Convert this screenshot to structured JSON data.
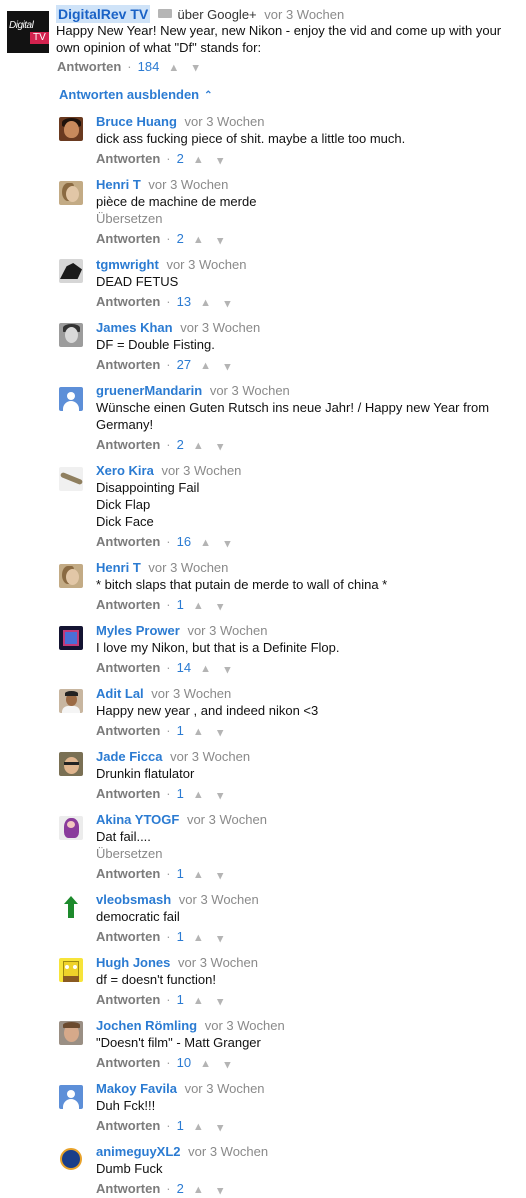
{
  "top_comment": {
    "author": "DigitalRev TV",
    "avatar_lines": [
      "Digital",
      "TV"
    ],
    "via": "über Google+",
    "time": "vor 3 Wochen",
    "text": "Happy New Year! New year, new Nikon - enjoy the vid and come up with your own opinion of what \"Df\" stands for:",
    "reply_label": "Antworten",
    "likes": "184"
  },
  "hide_replies": {
    "label": "Antworten ausblenden",
    "icon": "chevron-up-icon"
  },
  "ui": {
    "reply_label": "Antworten",
    "translate_label": "Übersetzen",
    "like_icon": "thumbs-up-icon",
    "dislike_icon": "thumbs-down-icon"
  },
  "replies": [
    {
      "author": "Bruce Huang",
      "time": "vor 3 Wochen",
      "lines": [
        "dick ass fucking piece of shit. maybe a little too much."
      ],
      "likes": "2"
    },
    {
      "author": "Henri T",
      "time": "vor 3 Wochen",
      "lines": [
        "pièce de machine de merde"
      ],
      "translate": "Übersetzen",
      "likes": "2"
    },
    {
      "author": "tgmwright",
      "time": "vor 3 Wochen",
      "lines": [
        "DEAD FETUS"
      ],
      "likes": "13"
    },
    {
      "author": "James Khan",
      "time": "vor 3 Wochen",
      "lines": [
        "DF = Double Fisting."
      ],
      "likes": "27"
    },
    {
      "author": "gruenerMandarin",
      "time": "vor 3 Wochen",
      "lines": [
        "Wünsche einen Guten Rutsch ins neue Jahr! / Happy new Year from",
        "Germany!"
      ],
      "likes": "2"
    },
    {
      "author": "Xero Kira",
      "time": "vor 3 Wochen",
      "lines": [
        "Disappointing Fail",
        "Dick Flap",
        "Dick Face"
      ],
      "likes": "16"
    },
    {
      "author": "Henri T",
      "time": "vor 3 Wochen",
      "lines": [
        "* bitch slaps that putain de merde to wall of china *"
      ],
      "likes": "1"
    },
    {
      "author": "Myles Prower",
      "time": "vor 3 Wochen",
      "lines": [
        "I love my Nikon, but that is a Definite Flop."
      ],
      "likes": "14"
    },
    {
      "author": "Adit Lal",
      "time": "vor 3 Wochen",
      "lines": [
        "Happy new year , and indeed nikon <3"
      ],
      "likes": "1"
    },
    {
      "author": "Jade Ficca",
      "time": "vor 3 Wochen",
      "lines": [
        "Drunkin flatulator"
      ],
      "likes": "1"
    },
    {
      "author": "Akina YTOGF",
      "time": "vor 3 Wochen",
      "lines": [
        "Dat fail...."
      ],
      "translate": "Übersetzen",
      "likes": "1"
    },
    {
      "author": "vleobsmash",
      "time": "vor 3 Wochen",
      "lines": [
        "democratic fail"
      ],
      "likes": "1"
    },
    {
      "author": "Hugh Jones",
      "time": "vor 3 Wochen",
      "lines": [
        "df = doesn't function!"
      ],
      "likes": "1"
    },
    {
      "author": "Jochen Römling",
      "time": "vor 3 Wochen",
      "lines": [
        "\"Doesn't film\" - Matt Granger"
      ],
      "likes": "10"
    },
    {
      "author": "Makoy Favila",
      "time": "vor 3 Wochen",
      "lines": [
        "Duh Fck!!!"
      ],
      "likes": "1"
    },
    {
      "author": "animeguyXL2",
      "time": "vor 3 Wochen",
      "lines": [
        "Dumb Fuck"
      ],
      "likes": "2"
    }
  ]
}
